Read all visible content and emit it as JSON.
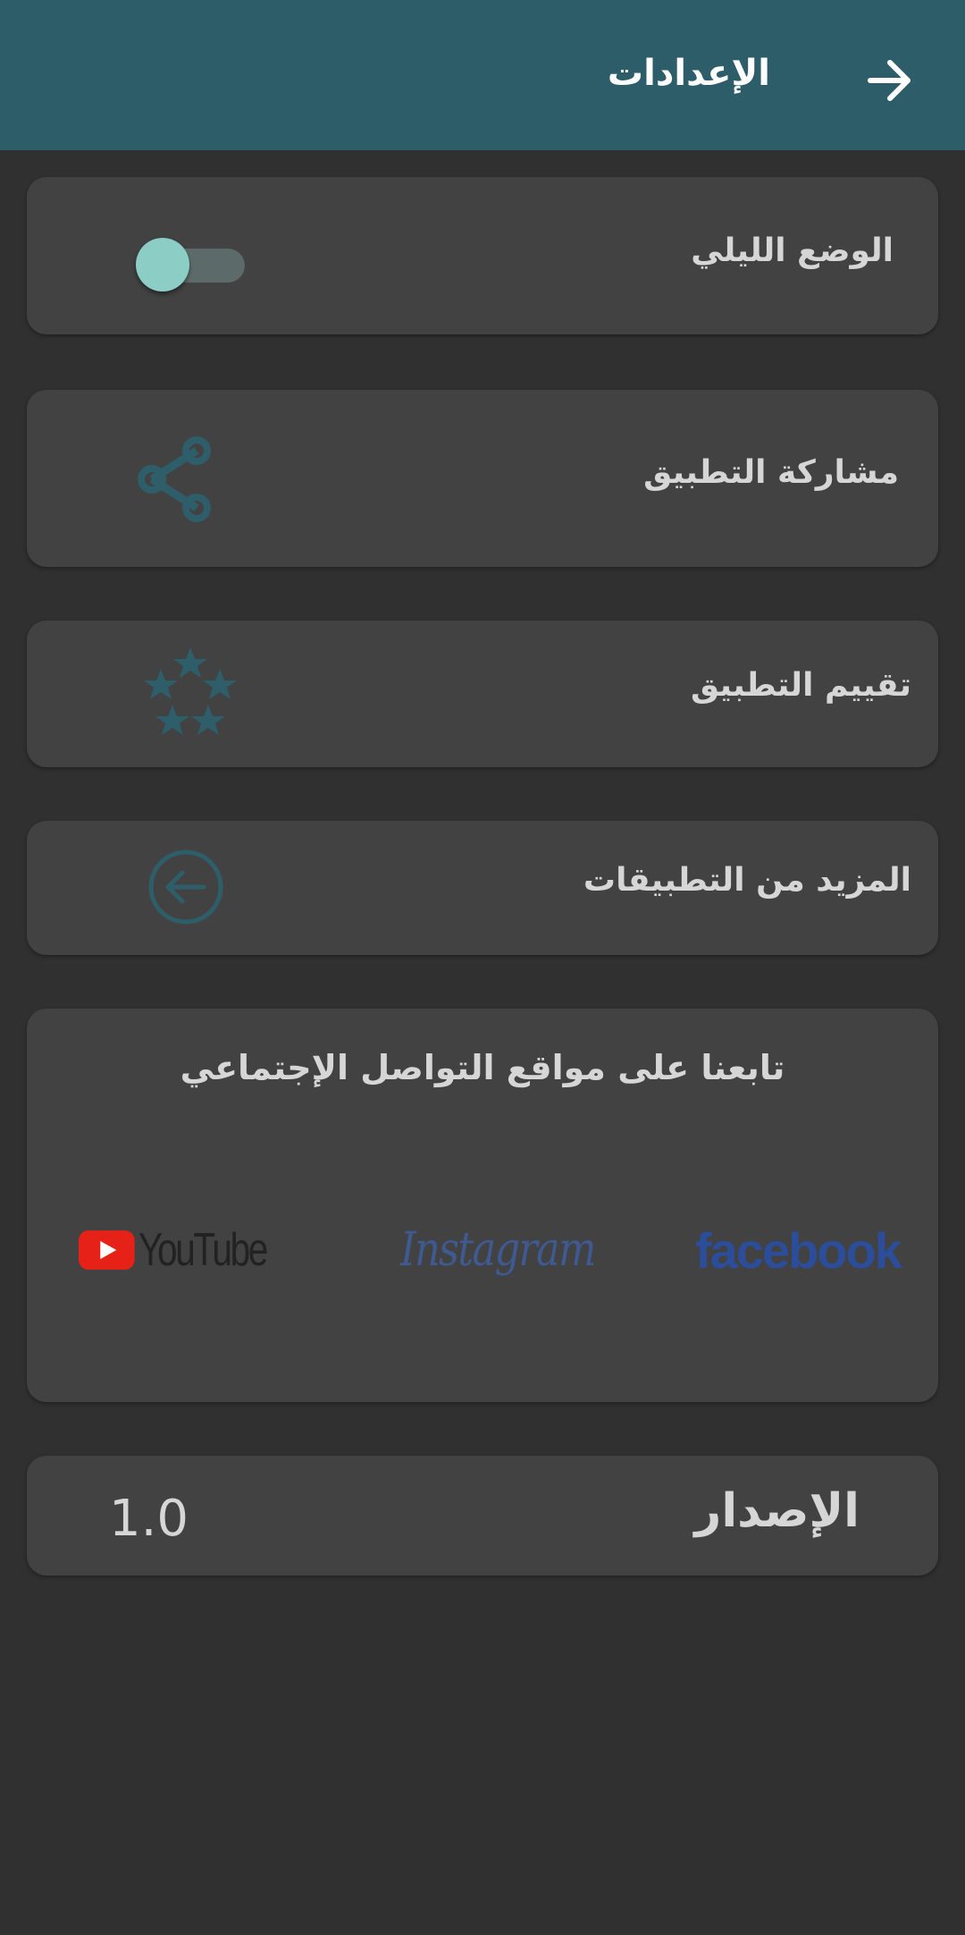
{
  "header": {
    "title": "الإعدادات",
    "back_icon": "arrow-right-icon",
    "background_color": "#2c5d69"
  },
  "settings": {
    "night_mode": {
      "label": "الوضع الليلي",
      "enabled": false
    },
    "share_app": {
      "label": "مشاركة التطبيق",
      "icon": "share-icon"
    },
    "rate_app": {
      "label": "تقييم التطبيق",
      "icon": "stars-icon"
    },
    "more_apps": {
      "label": "المزيد من التطبيقات",
      "icon": "circle-arrow-left-icon"
    }
  },
  "social": {
    "title": "تابعنا على مواقع التواصل الإجتماعي",
    "links": {
      "youtube": "YouTube",
      "instagram": "Instagram",
      "facebook": "facebook"
    }
  },
  "version": {
    "label": "الإصدار",
    "value": "1.0"
  },
  "colors": {
    "background": "#303030",
    "card": "#424242",
    "accent_icon": "#2e5e6a",
    "toggle_thumb": "#8ccdc6",
    "facebook_blue": "#2b4d9a",
    "instagram_blue": "#3e5a90",
    "youtube_red": "#e62117"
  }
}
